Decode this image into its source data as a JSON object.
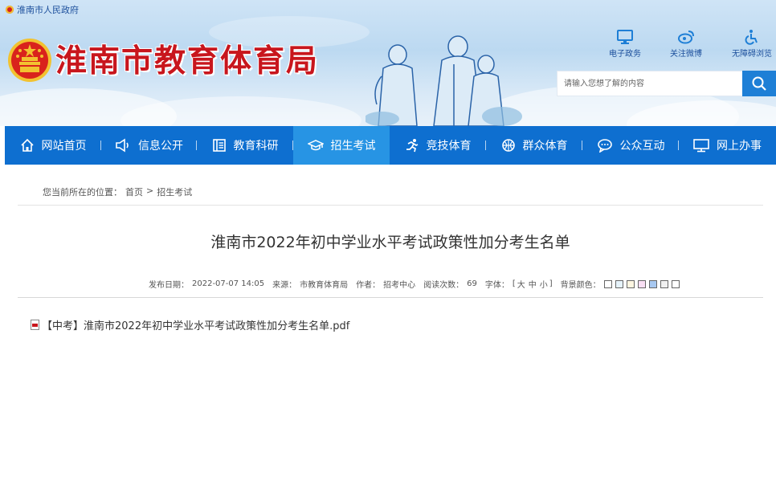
{
  "header": {
    "top_link": "淮南市人民政府",
    "site_title": "淮南市教育体育局",
    "quick_links": [
      {
        "label": "电子政务",
        "icon": "monitor-icon"
      },
      {
        "label": "关注微博",
        "icon": "weibo-icon"
      },
      {
        "label": "无障碍浏览",
        "icon": "wheelchair-icon"
      }
    ],
    "search_placeholder": "请输入您想了解的内容"
  },
  "nav": {
    "items": [
      {
        "label": "网站首页",
        "icon": "home-icon",
        "active": false
      },
      {
        "label": "信息公开",
        "icon": "megaphone-icon",
        "active": false
      },
      {
        "label": "教育科研",
        "icon": "book-icon",
        "active": false
      },
      {
        "label": "招生考试",
        "icon": "graduation-cap-icon",
        "active": true
      },
      {
        "label": "竞技体育",
        "icon": "runner-icon",
        "active": false
      },
      {
        "label": "群众体育",
        "icon": "ball-icon",
        "active": false
      },
      {
        "label": "公众互动",
        "icon": "chat-icon",
        "active": false
      },
      {
        "label": "网上办事",
        "icon": "computer-icon",
        "active": false
      }
    ]
  },
  "breadcrumb": {
    "prefix": "您当前所在的位置：",
    "home": "首页",
    "separator": ">",
    "current": "招生考试"
  },
  "article": {
    "title": "淮南市2022年初中学业水平考试政策性加分考生名单",
    "meta": {
      "publish_label": "发布日期：",
      "publish_date": "2022-07-07 14:05",
      "source_label": "来源：",
      "source": "市教育体育局",
      "author_label": "作者：",
      "author": "招考中心",
      "views_label": "阅读次数：",
      "views": "69",
      "font_label": "字体：",
      "font_open": "[",
      "font_large": "大",
      "font_medium": "中",
      "font_small": "小",
      "font_close": "]",
      "bg_label": "背景颜色："
    },
    "bg_swatches": [
      "#ffffff",
      "#e6f3fb",
      "#fdf6e1",
      "#f9dff4",
      "#a8c8f0",
      "#f0f0f0",
      "#ffffff"
    ],
    "attachment": "【中考】淮南市2022年初中学业水平考试政策性加分考生名单.pdf"
  }
}
